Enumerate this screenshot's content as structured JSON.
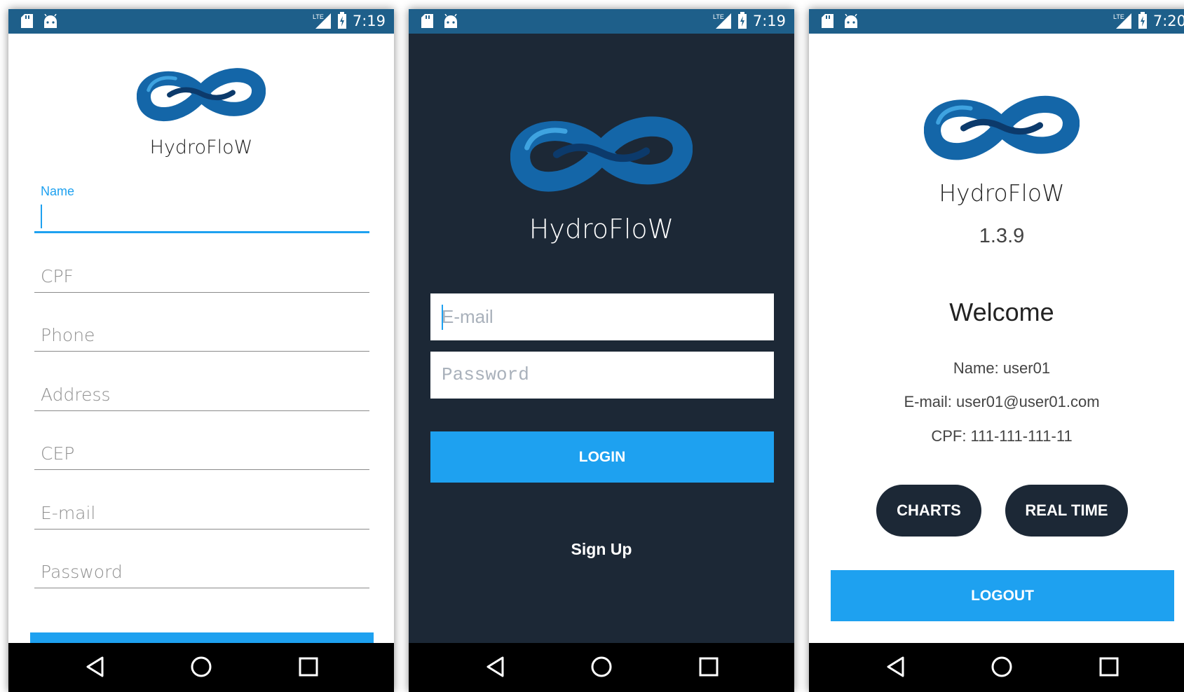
{
  "status": {
    "time1": "7:19",
    "time2": "7:19",
    "time3": "7:20",
    "network": "LTE"
  },
  "brand": {
    "name": "HydroFloW"
  },
  "signup": {
    "name_label": "Name",
    "fields": [
      "CPF",
      "Phone",
      "Address",
      "CEP",
      "E-mail",
      "Password"
    ]
  },
  "login": {
    "email_placeholder": "E-mail",
    "password_placeholder": "Password",
    "login_button": "LOGIN",
    "signup_link": "Sign Up"
  },
  "home": {
    "version": "1.3.9",
    "welcome": "Welcome",
    "name_line": "Name: user01",
    "email_line": "E-mail: user01@user01.com",
    "cpf_line": "CPF: 111-111-111-11",
    "charts_button": "CHARTS",
    "realtime_button": "REAL TIME",
    "logout_button": "LOGOUT"
  },
  "colors": {
    "accent": "#1ea1f0",
    "dark": "#1c2836",
    "status_bar": "#1e5f8a",
    "logo_blue": "#1466a8"
  },
  "icons": [
    "sd-card-icon",
    "android-icon",
    "lte-signal-icon",
    "battery-charging-icon",
    "back-icon",
    "home-icon",
    "recents-icon"
  ]
}
